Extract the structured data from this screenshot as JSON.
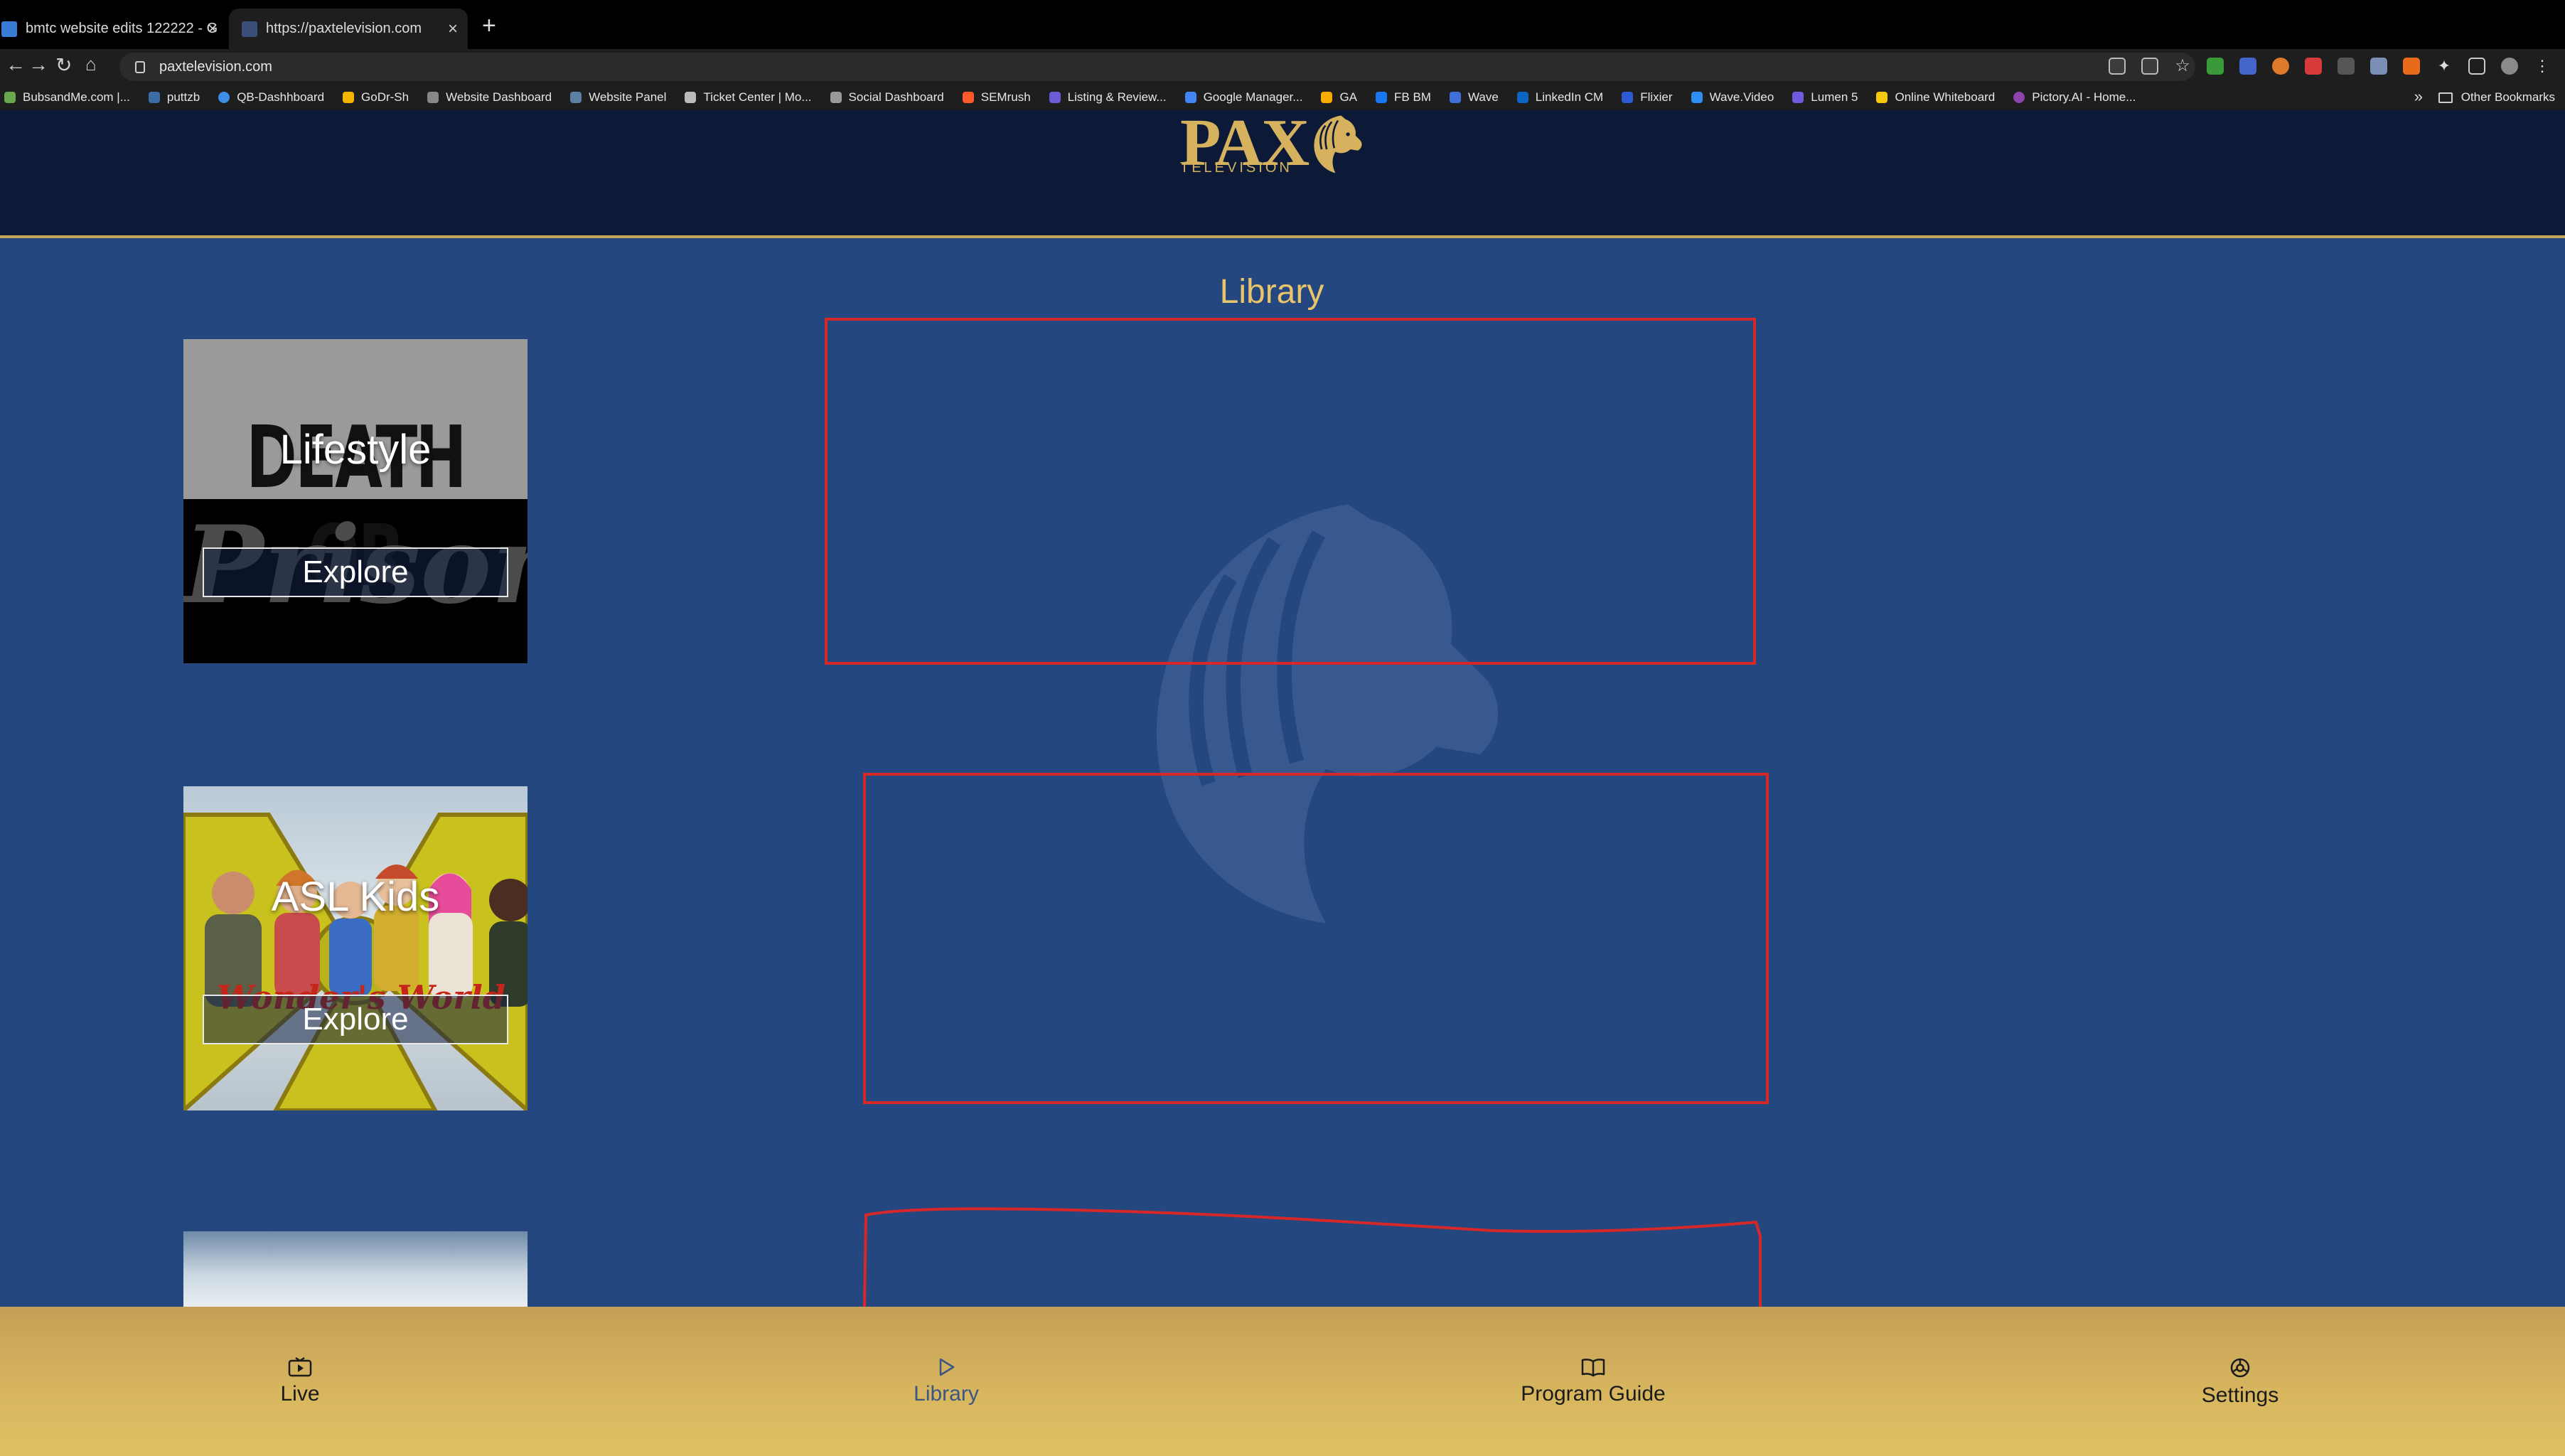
{
  "browser": {
    "tabs": [
      {
        "title": "bmtc website edits 122222 - G"
      },
      {
        "title": "https://paxtelevision.com"
      }
    ],
    "url": "paxtelevision.com",
    "bookmarks": [
      "BubsandMe.com |...",
      "puttzb",
      "QB-Dashhboard",
      "GoDr-Sh",
      "Website Dashboard",
      "Website Panel",
      "Ticket Center | Mo...",
      "Social Dashboard",
      "SEMrush",
      "Listing & Review...",
      "Google Manager...",
      "GA",
      "FB BM",
      "Wave",
      "LinkedIn CM",
      "Flixier",
      "Wave.Video",
      "Lumen 5",
      "Online Whiteboard",
      "Pictory.AI - Home..."
    ],
    "bookmarks_overflow": "»",
    "other_bookmarks": "Other Bookmarks"
  },
  "site": {
    "logo_text": "PAX",
    "logo_sub": "TELEVISION",
    "page_title": "Library",
    "categories": [
      {
        "title": "Lifestyle",
        "button": "Explore",
        "artwork_text": [
          "DEATH OR",
          "Prison"
        ]
      },
      {
        "title": "ASL Kids",
        "button": "Explore",
        "artwork_text": [
          "Wonder's World"
        ]
      },
      {
        "title": "",
        "button": ""
      }
    ],
    "bottom_nav": [
      {
        "label": "Live",
        "icon": "tv-play-icon",
        "active": false
      },
      {
        "label": "Library",
        "icon": "play-icon",
        "active": true
      },
      {
        "label": "Program Guide",
        "icon": "book-icon",
        "active": false
      },
      {
        "label": "Settings",
        "icon": "settings-icon",
        "active": false
      }
    ]
  },
  "colors": {
    "page_bg": "#25477f",
    "header_bg": "#0c1a38",
    "gold": "#d6b25e",
    "title_gold": "#e9c46a",
    "annotation_red": "#d62828",
    "active_nav": "#3b5584"
  }
}
